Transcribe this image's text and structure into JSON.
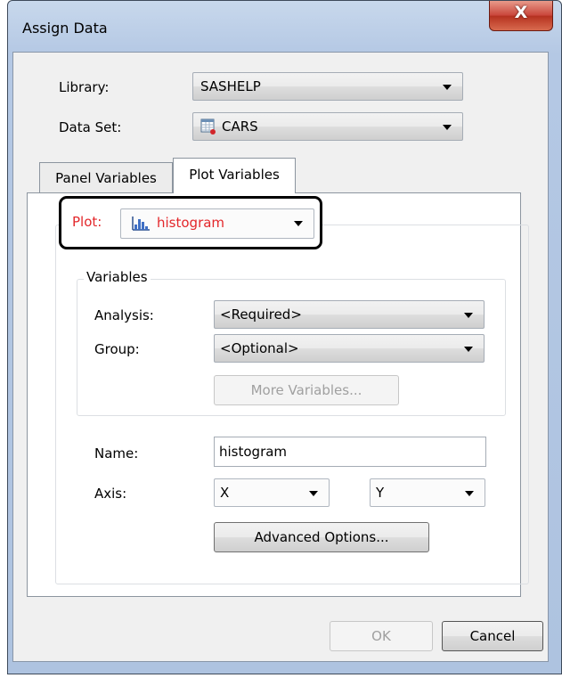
{
  "window": {
    "title": "Assign Data",
    "close_label": "X"
  },
  "library": {
    "label": "Library:",
    "value": "SASHELP"
  },
  "dataset": {
    "label": "Data Set:",
    "value": "CARS",
    "icon": "dataset-table-icon"
  },
  "tabs": [
    {
      "label": "Panel Variables",
      "active": false
    },
    {
      "label": "Plot Variables",
      "active": true
    }
  ],
  "plot": {
    "label": "Plot:",
    "value": "histogram",
    "label_color": "#e3272b",
    "icon": "histogram-icon"
  },
  "variables": {
    "group_title": "Variables",
    "analysis": {
      "label": "Analysis:",
      "value": "<Required>"
    },
    "group": {
      "label": "Group:",
      "value": "<Optional>"
    },
    "more_label": "More Variables..."
  },
  "name": {
    "label": "Name:",
    "value": "histogram"
  },
  "axis": {
    "label": "Axis:",
    "x_value": "X",
    "y_value": "Y"
  },
  "advanced_label": "Advanced Options...",
  "footer": {
    "ok_label": "OK",
    "cancel_label": "Cancel"
  }
}
